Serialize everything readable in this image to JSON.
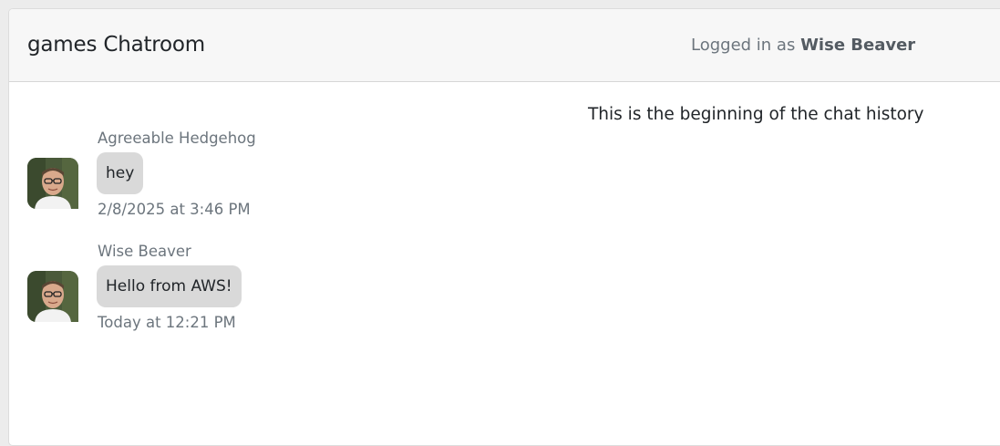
{
  "header": {
    "room_title": "games Chatroom",
    "logged_in_prefix": "Logged in as",
    "logged_in_user": "Wise Beaver"
  },
  "chat": {
    "history_note": "This is the beginning of the chat history",
    "messages": [
      {
        "sender": "Agreeable Hedgehog",
        "text": "hey",
        "timestamp": "2/8/2025 at 3:46 PM",
        "avatar_icon": "user-avatar-photo"
      },
      {
        "sender": "Wise Beaver",
        "text": "Hello from AWS!",
        "timestamp": "Today at 12:21 PM",
        "avatar_icon": "user-avatar-photo"
      }
    ]
  },
  "colors": {
    "header_bg": "#f7f7f7",
    "bubble_bg": "#d9d9d9",
    "muted_text": "#6c757d"
  }
}
